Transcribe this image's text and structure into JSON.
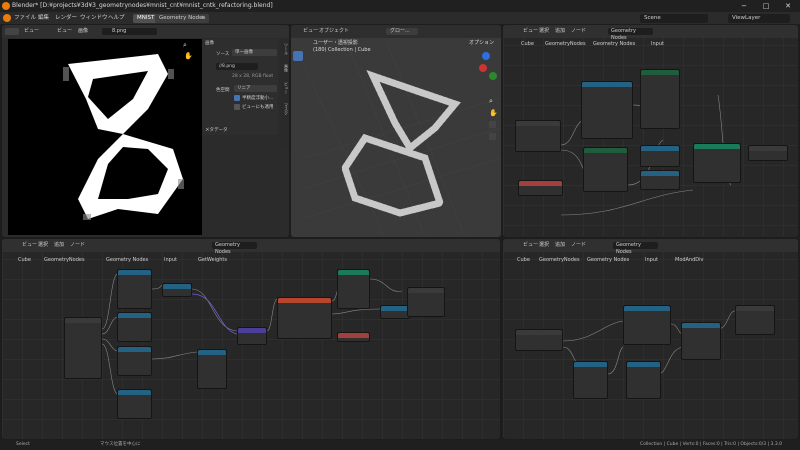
{
  "window": {
    "title": "Blender* [D:¥projects¥3d¥3_geometrynodes¥mnist_cnt¥mnist_cntk_refactoring.blend]",
    "min": "−",
    "max": "□",
    "close": "✕"
  },
  "menu": {
    "items": [
      "ファイル",
      "編集",
      "レンダー",
      "ウィンドウ",
      "ヘルプ"
    ],
    "workspaces": [
      "MNIST",
      "Geometry Nodes"
    ],
    "add": "+",
    "scene": "Scene",
    "view_layer": "ViewLayer"
  },
  "image_editor": {
    "header": [
      "ビュー",
      "ビュー",
      "画像"
    ],
    "image_name": "8.png",
    "panel": {
      "section": "画像",
      "source_label": "ソース",
      "source_value": "単一画像",
      "file": "//8.png",
      "info": "28 x 28, RGB float",
      "colorspace_label": "色空間",
      "colorspace_value": "リニア",
      "cb1": "半精度浮動小...",
      "cb2": "ビューにも適用",
      "meta": "メタデータ"
    },
    "tabs": [
      "ツール",
      "画像",
      "ビュー",
      "マスク"
    ]
  },
  "viewport": {
    "mode": "オブジェクト",
    "header": [
      "ビュー",
      "オブジェクト"
    ],
    "view": "グロー...",
    "title": "ユーザー・透視投影",
    "subtitle": "(180) Collection | Cube",
    "options": "オプション"
  },
  "ne1": {
    "header": [
      "ビュー",
      "選択",
      "追加",
      "ノード"
    ],
    "tree": "Geometry Nodes",
    "crumbs": [
      "Cube",
      "GeometryNodes",
      "Geometry Nodes",
      "Input"
    ]
  },
  "ne2": {
    "header": [
      "ビュー",
      "選択",
      "追加",
      "ノード"
    ],
    "tree": "Geometry Nodes",
    "crumbs": [
      "Cube",
      "GeometryNodes",
      "Geometry Nodes",
      "Input",
      "GetWeights"
    ]
  },
  "ne3": {
    "header": [
      "ビュー",
      "選択",
      "追加",
      "ノード"
    ],
    "tree": "Geometry Nodes",
    "crumbs": [
      "Cube",
      "GeometryNodes",
      "Geometry Nodes",
      "Input",
      "ModAndDiv"
    ]
  },
  "status": {
    "left": "Select",
    "mid": "マウス位置を中心に",
    "right": "Collection | Cube | Verts:0 | Faces:0 | Tris:0 | Objects:0/3 | 3.3.0"
  },
  "colors": {
    "accent": "#4772b3",
    "input_node": "#a3403e",
    "group_node": "#1f5d3c",
    "math_node": "#246283",
    "geo_node": "#1a7a5a",
    "orange": "#e87d0d"
  }
}
